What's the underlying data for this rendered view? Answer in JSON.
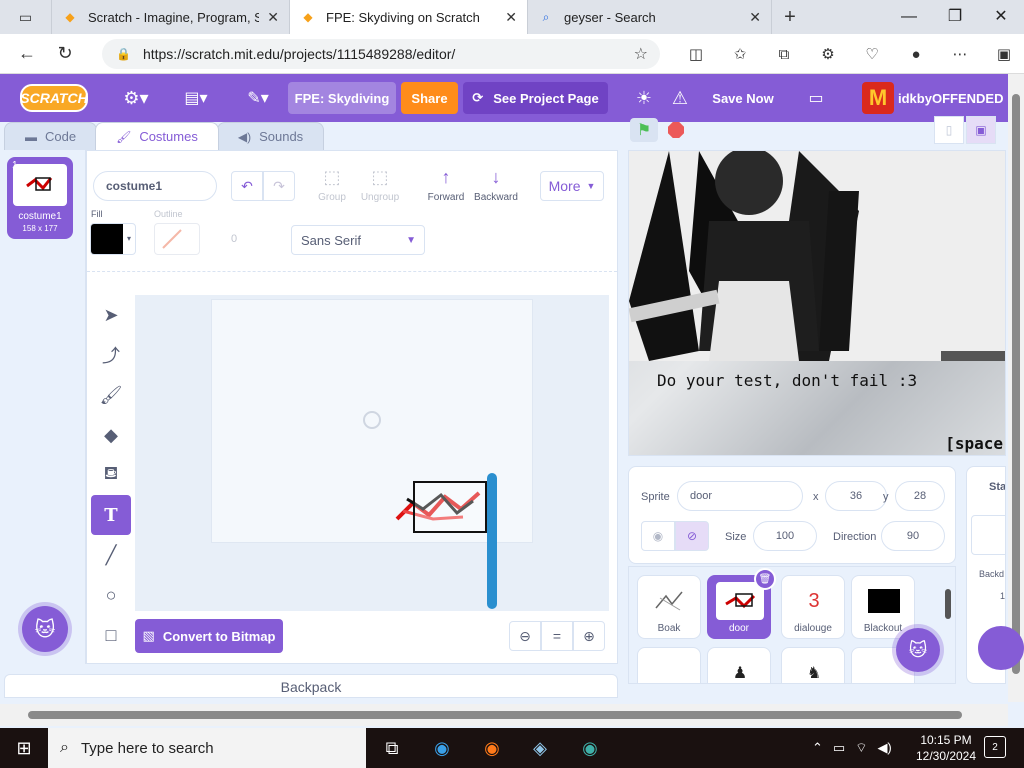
{
  "browser": {
    "tabs": [
      {
        "title": "Scratch - Imagine, Program, Share",
        "active": false
      },
      {
        "title": "FPE: Skydiving on Scratch",
        "active": true
      },
      {
        "title": "geyser - Search",
        "active": false
      }
    ],
    "url": "https://scratch.mit.edu/projects/1115489288/editor/"
  },
  "menubar": {
    "logo": "SCRATCH",
    "project_title": "FPE: Skydiving",
    "share": "Share",
    "see_project_page": "See Project Page",
    "save_now": "Save Now",
    "username": "idkbyOFFENDED"
  },
  "editor_tabs": [
    {
      "label": "Code",
      "active": false
    },
    {
      "label": "Costumes",
      "active": true
    },
    {
      "label": "Sounds",
      "active": false
    }
  ],
  "costume_list": [
    {
      "number": "1",
      "name": "costume1",
      "size": "158 x 177"
    }
  ],
  "paint": {
    "costume_name": "costume1",
    "group": "Group",
    "ungroup": "Ungroup",
    "forward": "Forward",
    "backward": "Backward",
    "more": "More",
    "fill_label": "Fill",
    "outline_label": "Outline",
    "outline_width": "0",
    "font": "Sans Serif",
    "convert_button": "Convert to Bitmap",
    "active_tool": "text"
  },
  "backpack": "Backpack",
  "stage": {
    "dialog": "Do your test, don't fail :3",
    "prompt": "[space"
  },
  "sprite_info": {
    "sprite_label": "Sprite",
    "sprite_name": "door",
    "x_label": "x",
    "x": "36",
    "y_label": "y",
    "y": "28",
    "size_label": "Size",
    "size": "100",
    "direction_label": "Direction",
    "direction": "90"
  },
  "sprites": [
    {
      "name": "Boak",
      "selected": false
    },
    {
      "name": "door",
      "selected": true
    },
    {
      "name": "dialouge",
      "selected": false,
      "thumb_text": "3"
    },
    {
      "name": "Blackout",
      "selected": false
    }
  ],
  "stage_panel": {
    "title": "Stag",
    "backdrops_label": "Backd",
    "backdrops_count": "1"
  },
  "taskbar": {
    "search_placeholder": "Type here to search",
    "time": "10:15 PM",
    "date": "12/30/2024",
    "notifications": "2"
  },
  "colors": {
    "scratch_purple": "#855cd6",
    "share_orange": "#ff8c1a",
    "fill": "#000000"
  }
}
